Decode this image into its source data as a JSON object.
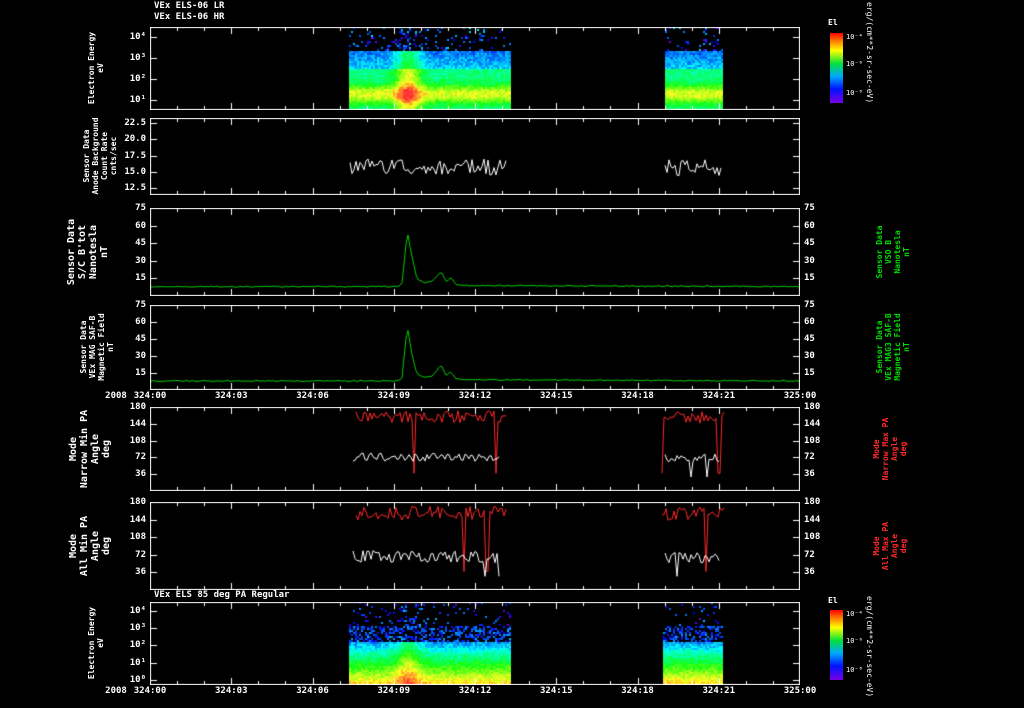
{
  "units": {
    "flux": "erg/(cm**2-sr-sec-eV)",
    "colorbar_title": "El"
  },
  "xaxis": {
    "year": "2008",
    "hours": [
      0,
      3,
      6,
      9,
      12,
      15,
      18,
      21,
      24
    ],
    "tick_labels": [
      "324:00",
      "324:03",
      "324:06",
      "324:09",
      "324:12",
      "324:15",
      "324:18",
      "324:21",
      "325:00"
    ]
  },
  "chart_data": [
    {
      "type": "heatmap",
      "titles": [
        "VEx ELS-06 LR",
        "VEx ELS-06 HR"
      ],
      "ylabel_lines": [
        "Electron Energy",
        "eV"
      ],
      "ytick_labels": [
        "10⁴",
        "10³",
        "10²",
        "10¹"
      ],
      "ylog_decades": [
        4,
        3,
        2,
        1
      ],
      "ylog_range": [
        0.5,
        4.5
      ],
      "x_range_hours": [
        0,
        24
      ],
      "active_intervals": [
        [
          7.35,
          13.3
        ],
        [
          19.0,
          21.15
        ]
      ],
      "disturbance_hour": 9.5,
      "profile": "els_lr",
      "colorbar_ticks": [
        "10⁻⁴",
        "10⁻⁶",
        "10⁻⁸"
      ]
    },
    {
      "type": "line",
      "ylabel_lines": [
        "Sensor Data",
        "Anode Background",
        "Count Rate",
        "cnts/sec"
      ],
      "ytick_labels": [
        "22.5",
        "20.0",
        "17.5",
        "15.0",
        "12.5"
      ],
      "yticks": [
        22.5,
        20.0,
        17.5,
        15.0,
        12.5
      ],
      "yrange": [
        11.5,
        23.2
      ],
      "series": [
        {
          "color": "#ffffff",
          "intervals": [
            [
              7.4,
              13.2
            ],
            [
              19.0,
              21.1
            ]
          ],
          "anchors": [
            [
              0,
              15.9
            ],
            [
              24,
              15.6
            ]
          ],
          "noise": 1.25
        }
      ]
    },
    {
      "type": "line",
      "ylabel_lines": [
        "Sensor Data",
        "S/C B'tot",
        "Nanotesla",
        "nT"
      ],
      "right_label_lines": [
        "Sensor Data",
        "VSO B",
        "Nanotesla",
        "nT"
      ],
      "right_label_color": "#00dd00",
      "ytick_labels": [
        "75",
        "60",
        "45",
        "30",
        "15"
      ],
      "yticks": [
        75,
        60,
        45,
        30,
        15
      ],
      "yrange": [
        0,
        75
      ],
      "yticks_right": true,
      "series": [
        {
          "color": "#00cc00",
          "intervals": [
            [
              0,
              24
            ]
          ],
          "noise": 0.5,
          "anchors": [
            [
              0,
              8
            ],
            [
              9.1,
              8
            ],
            [
              9.3,
              10
            ],
            [
              9.5,
              55
            ],
            [
              9.65,
              36
            ],
            [
              9.85,
              15
            ],
            [
              10.1,
              11.5
            ],
            [
              10.4,
              12
            ],
            [
              10.75,
              21
            ],
            [
              10.95,
              12
            ],
            [
              11.1,
              16
            ],
            [
              11.3,
              10
            ],
            [
              11.6,
              9
            ],
            [
              24,
              8
            ]
          ]
        }
      ]
    },
    {
      "type": "line",
      "ylabel_lines": [
        "Sensor Data",
        "VEx MAG SAF-B",
        "Magnetic Field",
        "nT"
      ],
      "right_label_lines": [
        "Sensor Data",
        "VEx MAG3 SAF-B",
        "Magnetic Field",
        "nT"
      ],
      "right_label_color": "#00dd00",
      "ytick_labels": [
        "75",
        "60",
        "45",
        "30",
        "15"
      ],
      "yticks": [
        75,
        60,
        45,
        30,
        15
      ],
      "yrange": [
        0,
        75
      ],
      "yticks_right": true,
      "series": [
        {
          "color": "#00cc00",
          "intervals": [
            [
              0,
              24
            ]
          ],
          "noise": 0.5,
          "anchors": [
            [
              0,
              8
            ],
            [
              9.1,
              8
            ],
            [
              9.3,
              10
            ],
            [
              9.5,
              57
            ],
            [
              9.65,
              34
            ],
            [
              9.85,
              14
            ],
            [
              10.1,
              11
            ],
            [
              10.4,
              12
            ],
            [
              10.75,
              22
            ],
            [
              10.95,
              12
            ],
            [
              11.1,
              16
            ],
            [
              11.3,
              10
            ],
            [
              11.6,
              9
            ],
            [
              24,
              8
            ]
          ]
        }
      ]
    },
    {
      "type": "line",
      "ylabel_lines": [
        "Mode",
        "Narrow Min PA",
        "Angle",
        "deg"
      ],
      "right_label_lines": [
        "Mode",
        "Narrow Max PA",
        "Angle",
        "deg"
      ],
      "right_label_color": "#ff2a2a",
      "ytick_labels": [
        "180",
        "144",
        "108",
        "72",
        "36"
      ],
      "yticks": [
        180,
        144,
        108,
        72,
        36
      ],
      "yrange": [
        0,
        180
      ],
      "yticks_right": true,
      "series": [
        {
          "color": "#ff2a2a",
          "intervals": [
            [
              7.6,
              13.15
            ],
            [
              18.9,
              21.2
            ]
          ],
          "anchors": [
            [
              0,
              160
            ],
            [
              24,
              158
            ]
          ],
          "noise": 13,
          "spike_prob": 0.05,
          "spike_value": 38,
          "clamp": [
            36,
            179
          ]
        },
        {
          "color": "#ffffff",
          "intervals": [
            [
              7.5,
              12.9
            ],
            [
              19.0,
              21.0
            ]
          ],
          "anchors": [
            [
              0,
              74
            ],
            [
              24,
              70
            ]
          ],
          "noise": 9,
          "spike_prob": 0.02,
          "spike_value": 30,
          "clamp": [
            24,
            178
          ]
        }
      ]
    },
    {
      "type": "line",
      "ylabel_lines": [
        "Mode",
        "All Min PA",
        "Angle",
        "deg"
      ],
      "right_label_lines": [
        "Mode",
        "All Max PA",
        "Angle",
        "deg"
      ],
      "right_label_color": "#ff2a2a",
      "ytick_labels": [
        "180",
        "144",
        "108",
        "72",
        "36"
      ],
      "yticks": [
        180,
        144,
        108,
        72,
        36
      ],
      "yrange": [
        0,
        180
      ],
      "yticks_right": true,
      "series": [
        {
          "color": "#ff2a2a",
          "intervals": [
            [
              7.6,
              13.15
            ],
            [
              18.9,
              21.2
            ]
          ],
          "anchors": [
            [
              0,
              158
            ],
            [
              24,
              156
            ]
          ],
          "noise": 14,
          "spike_prob": 0.05,
          "spike_value": 38,
          "clamp": [
            36,
            179
          ]
        },
        {
          "color": "#ffffff",
          "intervals": [
            [
              7.5,
              12.9
            ],
            [
              19.0,
              21.0
            ]
          ],
          "anchors": [
            [
              0,
              70
            ],
            [
              24,
              66
            ]
          ],
          "noise": 12,
          "spike_prob": 0.03,
          "spike_value": 28,
          "clamp": [
            22,
            178
          ]
        }
      ]
    },
    {
      "type": "heatmap",
      "titles": [
        "VEx ELS 85 deg PA Regular"
      ],
      "ylabel_lines": [
        "Electron Energy",
        "eV"
      ],
      "ytick_labels": [
        "10⁴",
        "10³",
        "10²",
        "10¹",
        "10⁰"
      ],
      "ylog_decades": [
        4,
        3,
        2,
        1,
        0
      ],
      "ylog_range": [
        -0.3,
        4.5
      ],
      "x_range_hours": [
        0,
        24
      ],
      "active_intervals": [
        [
          7.35,
          13.3
        ],
        [
          18.95,
          21.15
        ]
      ],
      "disturbance_hour": 9.5,
      "profile": "els_85",
      "colorbar_ticks": [
        "10⁻⁴",
        "10⁻⁶",
        "10⁻⁸"
      ]
    }
  ]
}
